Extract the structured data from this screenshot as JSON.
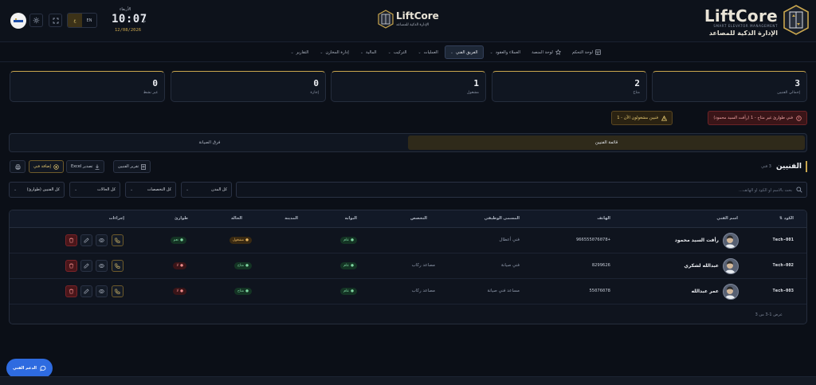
{
  "header": {
    "brand_name": "LiftCore",
    "brand_tagline": "SMART ELEVATOR MANAGEMENT",
    "brand_subtitle": "الإدارة الذكية للمصاعد",
    "center_name": "LiftCore",
    "center_subtitle": "الإدارة الذكية للمصاعد",
    "clock": {
      "day": "الأربعاء",
      "time": "10:07",
      "ampm": "م",
      "date": "12/08/2026"
    },
    "lang": {
      "en": "EN",
      "ar": "ع"
    }
  },
  "nav": [
    {
      "label": "لوحة التحكم",
      "icon": "dashboard-icon",
      "active": false,
      "dropdown": false
    },
    {
      "label": "لوحة المنصة",
      "icon": "star-icon",
      "active": false,
      "dropdown": false
    },
    {
      "label": "العملاء والعقود",
      "icon": "",
      "active": false,
      "dropdown": true
    },
    {
      "label": "الفريق الفني",
      "icon": "",
      "active": true,
      "dropdown": true
    },
    {
      "label": "العمليات",
      "icon": "",
      "active": false,
      "dropdown": true
    },
    {
      "label": "التركيب",
      "icon": "",
      "active": false,
      "dropdown": true
    },
    {
      "label": "المالية",
      "icon": "",
      "active": false,
      "dropdown": true
    },
    {
      "label": "إدارة المخازن",
      "icon": "",
      "active": false,
      "dropdown": true
    },
    {
      "label": "التقارير",
      "icon": "",
      "active": false,
      "dropdown": true
    }
  ],
  "stats": [
    {
      "value": "3",
      "label": "إجمالي الفنيين"
    },
    {
      "value": "2",
      "label": "متاح"
    },
    {
      "value": "1",
      "label": "مشغول"
    },
    {
      "value": "0",
      "label": "إجازة"
    },
    {
      "value": "0",
      "label": "غير نشط"
    }
  ],
  "alerts": {
    "red": "فني طوارئ غير متاح - 1 (رأفت السيد محمود)",
    "amber": "فنيين مشغولون الآن - 1"
  },
  "tabs": {
    "list": "قائمة الفنيين",
    "teams": "فرق الصيانة"
  },
  "section": {
    "title": "الفنيين",
    "count": "3 فني",
    "add": "إضافة فني",
    "export": "تصدير Excel",
    "report": "تقرير الفنيين"
  },
  "filters": {
    "search_placeholder": "بحث بالاسم أو الكود أو الهاتف...",
    "city": "كل المدن",
    "specialty": "كل التخصصات",
    "status": "كل الحالات",
    "type": "كل الفنيين (طوارئ)"
  },
  "table": {
    "headers": {
      "code": "الكود",
      "name": "اسم الفني",
      "phone": "الهاتف",
      "job": "المسمى الوظيفي",
      "specialty": "التخصص",
      "portal": "البوابة",
      "city": "المدينة",
      "status": "الحالة",
      "emergency": "طوارئ",
      "actions": "إجراءات"
    },
    "rows": [
      {
        "code": "Tech-001",
        "name": "رأفت السيد محمود",
        "phone": "+966555076078",
        "job": "فني أعطال",
        "specialty": "",
        "portal": "عام",
        "city": "",
        "status": "مشغول",
        "status_color": "amber",
        "emergency": "نعم",
        "emergency_color": "green"
      },
      {
        "code": "Tech-002",
        "name": "عبدالله لشكري",
        "phone": "8299626",
        "job": "فني صيانة",
        "specialty": "مصاعد ركاب",
        "portal": "عام",
        "city": "",
        "status": "متاح",
        "status_color": "green",
        "emergency": "لا",
        "emergency_color": "red"
      },
      {
        "code": "Tech-003",
        "name": "عمر عبدالله",
        "phone": "55076078",
        "job": "مساعد فني صيانة",
        "specialty": "مصاعد ركاب",
        "portal": "عام",
        "city": "",
        "status": "متاح",
        "status_color": "green",
        "emergency": "لا",
        "emergency_color": "red"
      }
    ],
    "footer": "عرض 1-3 من 3"
  },
  "support": {
    "label": "الدعم الفني"
  },
  "colors": {
    "accent": "#c9a64e",
    "background": "#0b0f17",
    "primary_blue": "#2e6be0"
  }
}
